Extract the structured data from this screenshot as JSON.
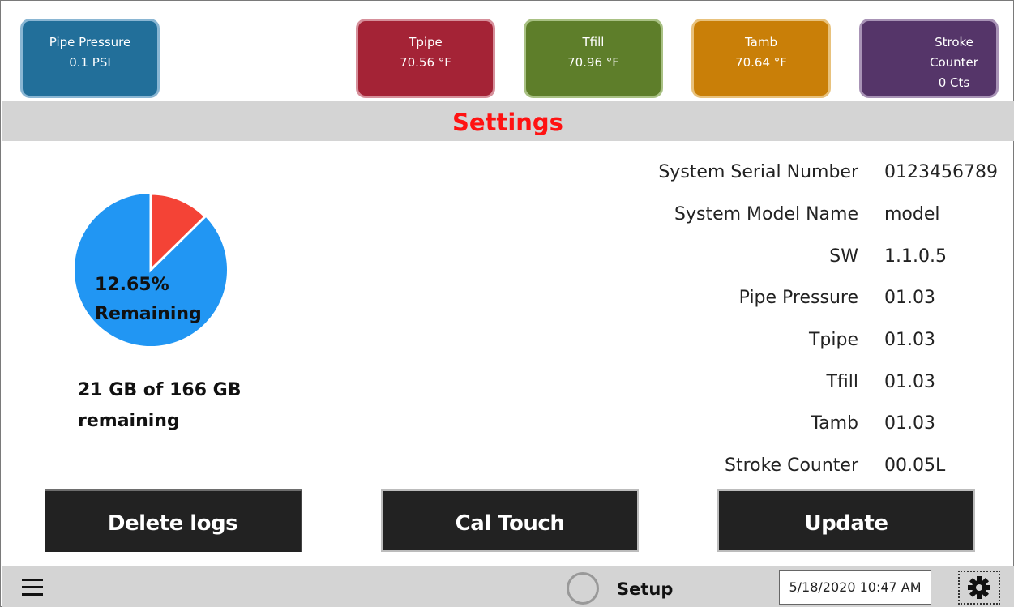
{
  "tiles": [
    {
      "label": "Pipe Pressure",
      "value": "0.1 PSI",
      "color": "#226f9a"
    },
    {
      "label": "Tpipe",
      "value": "70.56 °F",
      "color": "#a42336"
    },
    {
      "label": "Tfill",
      "value": "70.96 °F",
      "color": "#5e7e2a"
    },
    {
      "label": "Tamb",
      "value": "70.64 °F",
      "color": "#c97f08"
    },
    {
      "label": "Stroke Counter",
      "value": "0 Cts",
      "color": "#553569"
    }
  ],
  "page_title": "Settings",
  "storage": {
    "percent_label": "12.65%",
    "remaining_label": "Remaining",
    "summary": "21 GB of 166 GB remaining",
    "remaining_fraction": 0.1265,
    "used_color": "#2196f3",
    "remaining_color": "#f44336"
  },
  "info": [
    {
      "label": "System Serial Number",
      "value": "0123456789"
    },
    {
      "label": "System Model Name",
      "value": "model"
    },
    {
      "label": "SW",
      "value": "1.1.0.5"
    },
    {
      "label": "Pipe Pressure",
      "value": "01.03"
    },
    {
      "label": "Tpipe",
      "value": "01.03"
    },
    {
      "label": "Tfill",
      "value": "01.03"
    },
    {
      "label": "Tamb",
      "value": "01.03"
    },
    {
      "label": "Stroke Counter",
      "value": "00.05L"
    }
  ],
  "buttons": {
    "delete": "Delete logs",
    "cal_touch": "Cal Touch",
    "update": "Update"
  },
  "statusbar": {
    "setup_label": "Setup",
    "datetime": "5/18/2020 10:47 AM",
    "menu_icon": "hamburger-menu-icon",
    "status_icon": "circle-icon",
    "settings_icon": "gear-icon"
  }
}
